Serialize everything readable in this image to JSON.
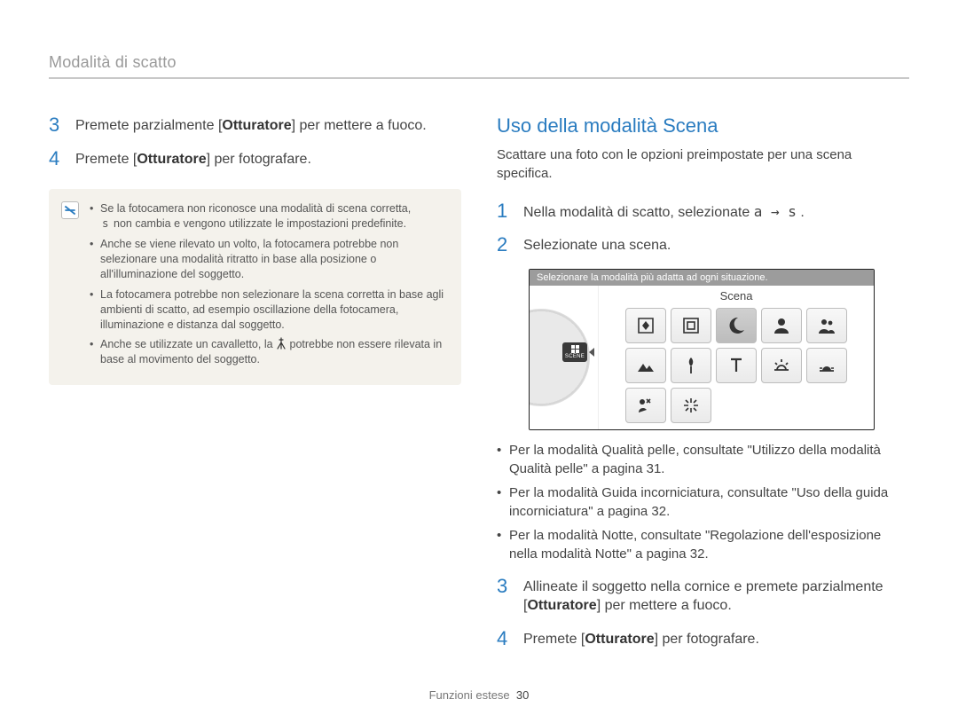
{
  "header": "Modalità di scatto",
  "left": {
    "step3": {
      "num": "3",
      "pre": "Premete parzialmente [",
      "bold": "Otturatore",
      "post": "] per mettere a fuoco."
    },
    "step4": {
      "num": "4",
      "pre": "Premete [",
      "bold": "Otturatore",
      "post": "] per fotografare."
    },
    "note": {
      "b1_line1": "Se la fotocamera non riconosce una modalità di scena corretta,",
      "b1_line2_s": "s",
      "b1_line2_rest": " non cambia e vengono utilizzate le impostazioni predefinite.",
      "b2": "Anche se viene rilevato un volto, la fotocamera potrebbe non selezionare una modalità ritratto in base alla posizione o all'illuminazione del soggetto.",
      "b3": "La fotocamera potrebbe non selezionare la scena corretta in base agli ambienti di scatto, ad esempio oscillazione della fotocamera, illuminazione e distanza dal soggetto.",
      "b4_pre": "Anche se utilizzate un cavalletto, la ",
      "b4_post": " potrebbe non essere rilevata in base al movimento del soggetto."
    }
  },
  "right": {
    "title": "Uso della modalità Scena",
    "intro": "Scattare una foto con le opzioni preimpostate per una scena specifica.",
    "step1": {
      "num": "1",
      "pre": "Nella modalità di scatto, selezionate ",
      "a": "a",
      "arrow": " → ",
      "s": "s",
      "post": " ."
    },
    "step2": {
      "num": "2",
      "text": "Selezionate una scena."
    },
    "lcd_top": "Selezionare la modalità più adatta ad ogni situazione.",
    "lcd_mode": "Scena",
    "scene_chip_label": "SCENE",
    "ref1": "Per la modalità Qualità pelle, consultate \"Utilizzo della modalità Qualità pelle\" a pagina 31.",
    "ref2": "Per la modalità Guida incorniciatura, consultate \"Uso della guida incorniciatura\" a pagina 32.",
    "ref3": "Per la modalità Notte, consultate \"Regolazione dell'esposizione nella modalità Notte\" a pagina 32.",
    "step3": {
      "num": "3",
      "line1_pre": "Allineate il soggetto nella cornice e premete parzialmente",
      "line2_pre": "[",
      "line2_bold": "Otturatore",
      "line2_post": "] per mettere a fuoco."
    },
    "step4": {
      "num": "4",
      "pre": "Premete [",
      "bold": "Otturatore",
      "post": "] per fotografare."
    }
  },
  "footer": {
    "section": "Funzioni estese",
    "page": "30"
  }
}
